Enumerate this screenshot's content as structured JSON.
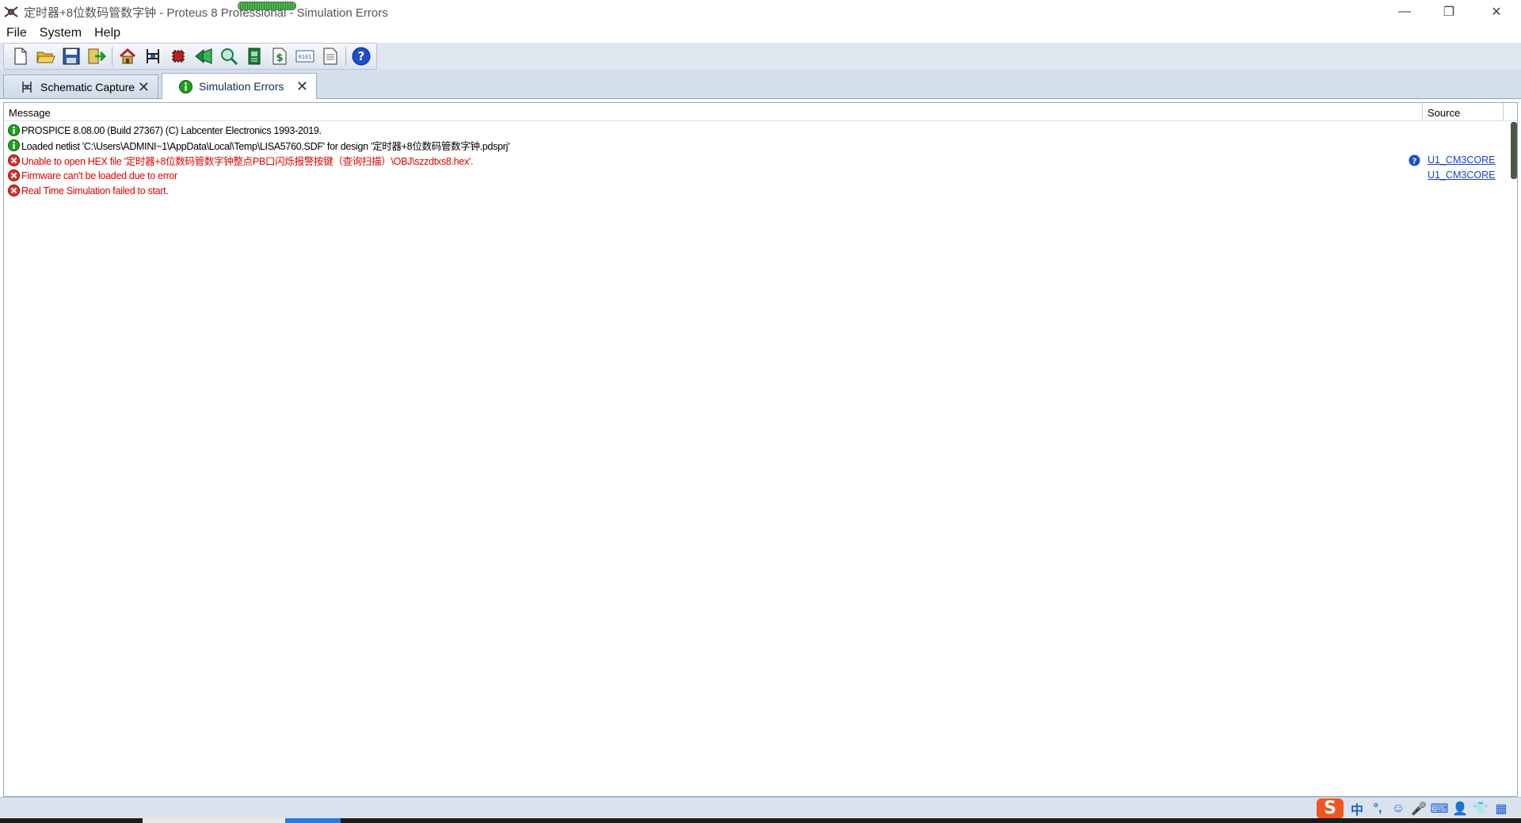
{
  "window": {
    "title": "定时器+8位数码管数字钟 - Proteus 8 Professional - Simulation Errors",
    "progress_fraction": 1.0,
    "controls": {
      "minimize": "—",
      "restore": "❐",
      "close": "✕"
    }
  },
  "menu": {
    "items": [
      {
        "label": "File"
      },
      {
        "label": "System"
      },
      {
        "label": "Help"
      }
    ]
  },
  "toolbar": {
    "buttons": [
      {
        "icon": "new-file-icon"
      },
      {
        "icon": "open-folder-icon"
      },
      {
        "icon": "save-icon"
      },
      {
        "icon": "import-icon"
      },
      {
        "icon": "home-icon"
      },
      {
        "icon": "schematic-icon"
      },
      {
        "icon": "chip-icon"
      },
      {
        "icon": "simulation-back-icon"
      },
      {
        "icon": "zoom-inspect-icon"
      },
      {
        "icon": "pcb-icon"
      },
      {
        "icon": "bill-of-materials-icon"
      },
      {
        "icon": "source-code-icon"
      },
      {
        "icon": "document-icon"
      },
      {
        "icon": "help-icon"
      }
    ]
  },
  "tabs": [
    {
      "label": "Schematic Capture",
      "active": false,
      "icon": "schematic-icon",
      "close": "✕"
    },
    {
      "label": "Simulation Errors",
      "active": true,
      "icon": "info-icon",
      "close": "✕"
    }
  ],
  "log": {
    "columns": {
      "message": "Message",
      "source": "Source"
    },
    "rows": [
      {
        "type": "info",
        "message": "PROSPICE 8.08.00 (Build 27367) (C) Labcenter Electronics 1993-2019.",
        "source": ""
      },
      {
        "type": "info",
        "message": "Loaded netlist 'C:\\Users\\ADMINI~1\\AppData\\Local\\Temp\\LISA5760.SDF' for design '定时器+8位数码管数字钟.pdsprj'",
        "source": ""
      },
      {
        "type": "error",
        "message": "Unable to open HEX file '定时器+8位数码管数字钟整点PB口闪烁报警按键（查询扫描）\\OBJ\\szzdtxs8.hex'.",
        "source": "U1_CM3CORE",
        "help": true
      },
      {
        "type": "error",
        "message": "Firmware can't be loaded due to error",
        "source": "U1_CM3CORE"
      },
      {
        "type": "error",
        "message": "Real Time Simulation failed to start.",
        "source": ""
      }
    ]
  },
  "statusbar": {
    "ime": {
      "logo": "S",
      "items": [
        "中",
        "°,",
        "☺",
        "🎤",
        "⌨",
        "👤",
        "👕",
        "▦"
      ]
    }
  },
  "colors": {
    "error_text": "#e00000",
    "link": "#1a3fd4",
    "info_icon": "#1fa01f",
    "error_icon": "#e03030"
  }
}
